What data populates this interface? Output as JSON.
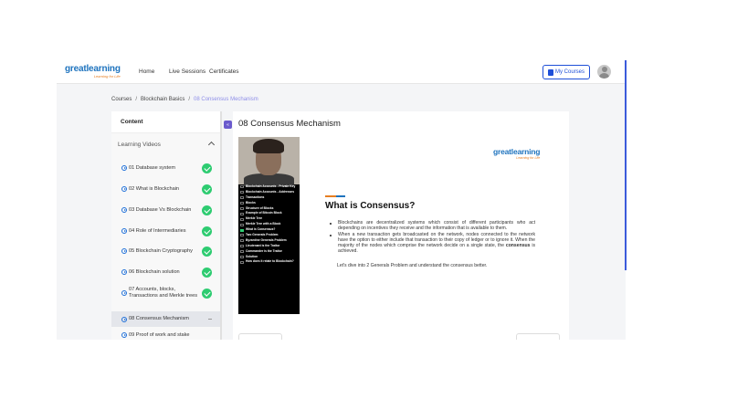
{
  "header": {
    "logo_main": "greatlearning",
    "logo_sub": "Learning for Life",
    "nav": [
      "Home",
      "Live Sessions",
      "Certificates"
    ],
    "my_courses": "My Courses"
  },
  "breadcrumb": [
    "Courses",
    "Blockchain Basics",
    "08 Consensus Mechanism"
  ],
  "sidebar": {
    "heading": "Content",
    "section": "Learning Videos",
    "items": [
      {
        "label": "01 Database system",
        "done": true
      },
      {
        "label": "02 What is Blockchain",
        "done": true
      },
      {
        "label": "03 Database Vs Blockchain",
        "done": true
      },
      {
        "label": "04 Role of Intermediaries",
        "done": true
      },
      {
        "label": "05 Blockchain Cryptography",
        "done": true
      },
      {
        "label": "06 Blockchain solution",
        "done": true
      },
      {
        "label": "07 Accounts, blocks, Transactions and Merkle trees",
        "done": true
      },
      {
        "label": "08 Consensus Mechanism",
        "done": false,
        "active": true
      },
      {
        "label": "09 Proof of work and stake",
        "done": false
      }
    ]
  },
  "main": {
    "title": "08 Consensus Mechanism",
    "video_topics": [
      "Blockchain Accounts - Private Key",
      "Blockchain Accounts - Addresses",
      "Transactions",
      "Blocks",
      "Structure of Blocks",
      "Example of Bitcoin Block",
      "Merkle Tree",
      "Merkle Tree with a Block",
      "What is Consensus?",
      "Two Generals Problem",
      "Byzantine Generals Problem",
      "Lieutenant is the Traitor",
      "Commander is the Traitor",
      "Solution",
      "How does it relate to Blockchain?"
    ],
    "slide": {
      "logo_main": "greatlearning",
      "logo_sub": "Learning for Life",
      "heading": "What is Consensus?",
      "bullet1": "Blockchains are decentralized systems which consist of different participants who act depending on incentives they receive and the information that is available to them.",
      "bullet2_pre": "When a new transaction gets broadcasted on the network, nodes connected to the network have the option to either include that transaction to their copy of ledger or to ignore it. When the majority of the nodes which comprise the network decide on a single state, the ",
      "bullet2_bold": "consensus",
      "bullet2_post": " is achieved.",
      "dive": "Let's dive into 2 Generals Problem and understand the consensus better."
    }
  },
  "colors": {
    "accent": "#1e4fd8",
    "check": "#2ecc71",
    "brand": "#1e73be",
    "brand_orange": "#e67e22"
  }
}
